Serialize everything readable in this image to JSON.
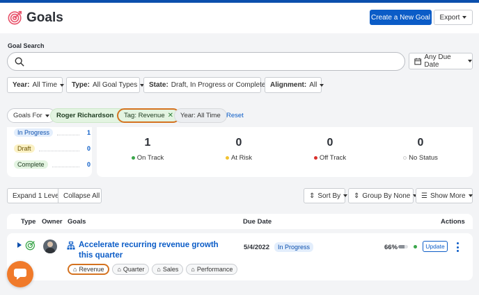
{
  "header": {
    "title": "Goals",
    "create_label": "Create a New Goal",
    "export_label": "Export"
  },
  "search": {
    "label": "Goal Search",
    "placeholder": "",
    "due_label": "Any Due Date"
  },
  "filters": [
    {
      "key": "Year:",
      "value": "All Time"
    },
    {
      "key": "Type:",
      "value": "All Goal Types"
    },
    {
      "key": "State:",
      "value": "Draft, In Progress or Complete"
    },
    {
      "key": "Alignment:",
      "value": "All"
    }
  ],
  "chips": {
    "goals_for": "Goals For",
    "person": "Roger Richardson",
    "tag": "Tag: Revenue",
    "year": "Year: All Time",
    "reset": "Reset"
  },
  "summary": {
    "states": [
      {
        "label": "In Progress",
        "count": "1"
      },
      {
        "label": "Draft",
        "count": "0"
      },
      {
        "label": "Complete",
        "count": "0"
      }
    ],
    "statuses": [
      {
        "count": "1",
        "label": "On Track",
        "color": "#3aa64a"
      },
      {
        "count": "0",
        "label": "At Risk",
        "color": "#f2c230"
      },
      {
        "count": "0",
        "label": "Off Track",
        "color": "#d9302c"
      },
      {
        "count": "0",
        "label": "No Status",
        "color": "#ffffff"
      }
    ]
  },
  "toolbar": {
    "expand": "Expand 1 Level",
    "collapse": "Collapse All",
    "sort": "Sort By",
    "group": "Group By None",
    "more": "Show More"
  },
  "table": {
    "headers": {
      "type": "Type",
      "owner": "Owner",
      "goals": "Goals",
      "due": "Due Date",
      "actions": "Actions"
    },
    "rows": [
      {
        "title": "Accelerate recurring revenue growth this quarter",
        "due": "5/4/2022",
        "status": "In Progress",
        "progress": "66%",
        "progress_value": 0.66,
        "update": "Update",
        "tags": [
          "Revenue",
          "Quarter",
          "Sales",
          "Performance"
        ]
      }
    ]
  },
  "colors": {
    "brand": "#0b5cc7",
    "accent": "#f07a2a",
    "logo": "#e8536b"
  }
}
